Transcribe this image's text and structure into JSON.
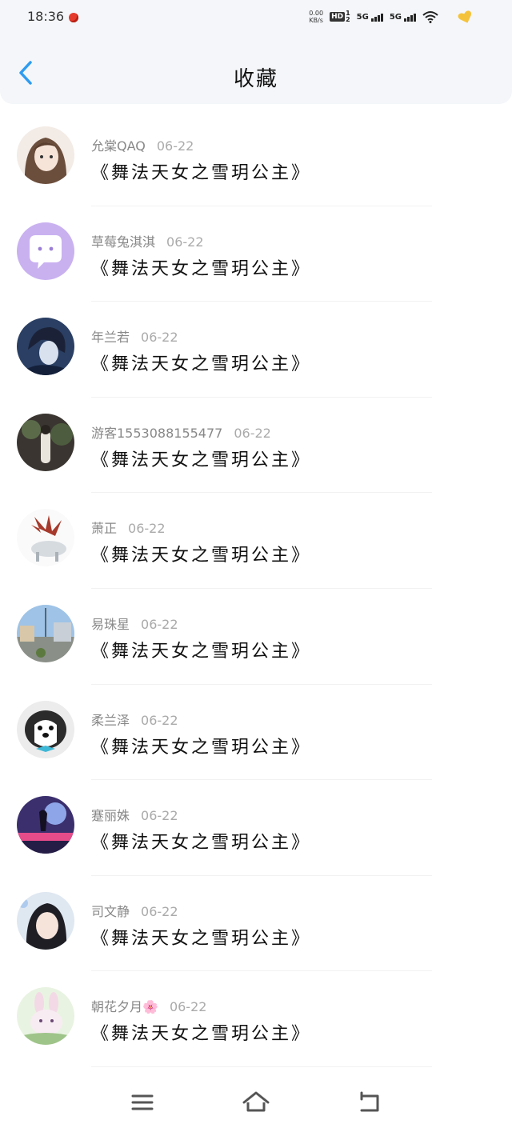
{
  "status_bar": {
    "time": "18:36",
    "net_speed_value": "0.00",
    "net_speed_unit": "KB/s",
    "hd_label": "HD",
    "sim1_label": "1",
    "sim2_label": "2",
    "signal1_label": "5G",
    "signal2_label": "5G",
    "icons": [
      "notification-dot-icon",
      "hd-icon",
      "signal-icon",
      "signal-icon",
      "wifi-icon",
      "heart-icon"
    ]
  },
  "header": {
    "title": "收藏",
    "back_icon": "chevron-left-icon",
    "accent_color": "#2e9bf0"
  },
  "favorites": [
    {
      "name": "允棠QAQ",
      "date": "06-22",
      "title": "《舞法天女之雪玥公主》"
    },
    {
      "name": "草莓兔淇淇",
      "date": "06-22",
      "title": "《舞法天女之雪玥公主》"
    },
    {
      "name": "年兰若",
      "date": "06-22",
      "title": "《舞法天女之雪玥公主》"
    },
    {
      "name": "游客1553088155477",
      "date": "06-22",
      "title": "《舞法天女之雪玥公主》"
    },
    {
      "name": "萧正",
      "date": "06-22",
      "title": "《舞法天女之雪玥公主》"
    },
    {
      "name": "易珠星",
      "date": "06-22",
      "title": "《舞法天女之雪玥公主》"
    },
    {
      "name": "柔兰泽",
      "date": "06-22",
      "title": "《舞法天女之雪玥公主》"
    },
    {
      "name": "蹇丽姝",
      "date": "06-22",
      "title": "《舞法天女之雪玥公主》"
    },
    {
      "name": "司文静",
      "date": "06-22",
      "title": "《舞法天女之雪玥公主》"
    },
    {
      "name": "朝花夕月🌸",
      "date": "06-22",
      "title": "《舞法天女之雪玥公主》"
    }
  ],
  "nav_bar": {
    "icons": [
      "menu-icon",
      "home-icon",
      "back-icon"
    ]
  }
}
